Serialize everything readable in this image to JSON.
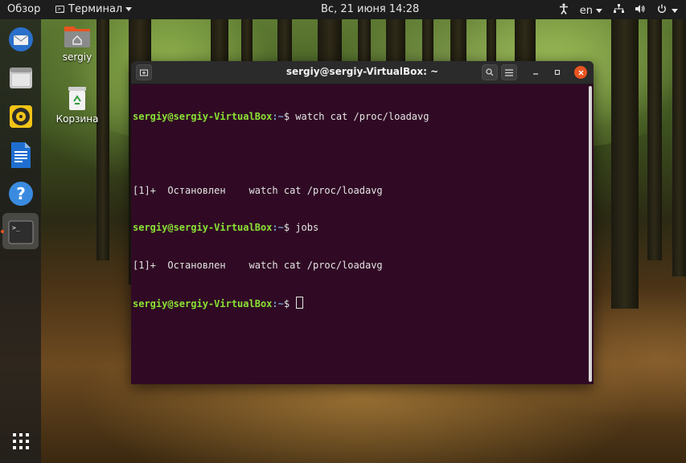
{
  "topbar": {
    "activities": "Обзор",
    "app_menu": "Терминал",
    "clock": "Вс, 21 июня  14:28",
    "keyboard_layout": "en"
  },
  "dock": {
    "items": [
      {
        "name": "thunderbird",
        "icon": "mail-icon"
      },
      {
        "name": "files",
        "icon": "folder-icon"
      },
      {
        "name": "rhythmbox",
        "icon": "music-player-icon"
      },
      {
        "name": "libreoffice-writer",
        "icon": "document-icon"
      },
      {
        "name": "help",
        "icon": "help-icon"
      },
      {
        "name": "terminal",
        "icon": "terminal-icon"
      }
    ],
    "apps_grid_icon": "app-grid-icon"
  },
  "desktop": {
    "icons": [
      {
        "label": "sergiy",
        "icon": "home-folder-icon"
      },
      {
        "label": "Корзина",
        "icon": "trash-icon"
      }
    ]
  },
  "terminal": {
    "title": "sergiy@sergiy-VirtualBox: ~",
    "prompt_user": "sergiy@sergiy-VirtualBox",
    "prompt_path": ":~",
    "prompt_symbol": "$ ",
    "lines": [
      {
        "type": "prompt",
        "command": "watch cat /proc/loadavg"
      },
      {
        "type": "output",
        "text": ""
      },
      {
        "type": "output",
        "text": "[1]+  Остановлен    watch cat /proc/loadavg"
      },
      {
        "type": "prompt",
        "command": "jobs"
      },
      {
        "type": "output",
        "text": "[1]+  Остановлен    watch cat /proc/loadavg"
      },
      {
        "type": "prompt",
        "command": "",
        "cursor": true
      }
    ]
  },
  "colors": {
    "terminal_bg": "#300a24",
    "prompt_user": "#8ae234",
    "prompt_path": "#729fcf",
    "accent": "#e95420"
  }
}
